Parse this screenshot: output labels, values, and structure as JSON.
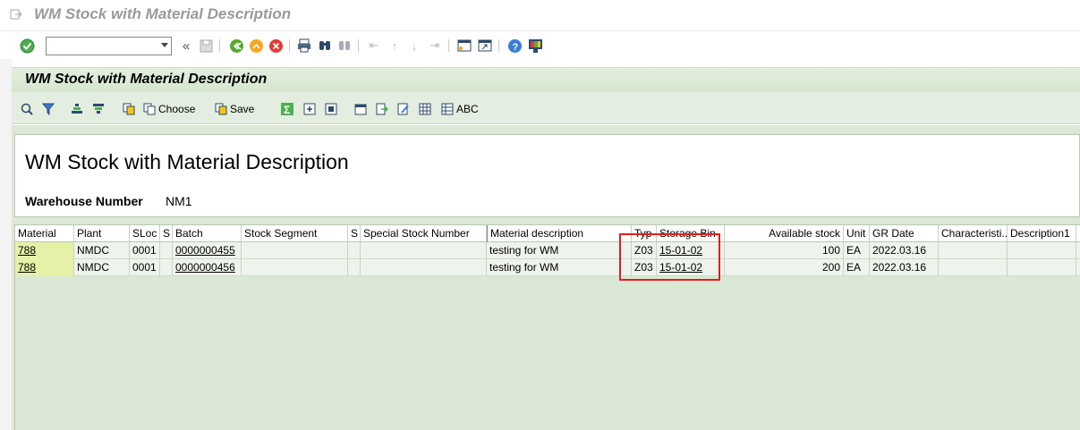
{
  "window": {
    "title": "WM Stock with Material Description"
  },
  "system_toolbar": {
    "command_field_value": ""
  },
  "app": {
    "title": "WM Stock with Material Description",
    "toolbar": {
      "choose_label": "Choose",
      "save_label": "Save",
      "abc_label": "ABC"
    }
  },
  "report": {
    "heading": "WM Stock with Material Description",
    "warehouse_label": "Warehouse Number",
    "warehouse_value": "NM1"
  },
  "table": {
    "columns": [
      "Material",
      "Plant",
      "SLoc",
      "S",
      "Batch",
      "Stock Segment",
      "S",
      "Special Stock Number",
      "Material description",
      "Typ",
      "Storage Bin",
      "Available stock",
      "Unit",
      "GR Date",
      "Characteristi...",
      "Description1"
    ],
    "rows": [
      [
        "788",
        "NMDC",
        "0001",
        "",
        "0000000455",
        "",
        "",
        "",
        "testing for WM",
        "Z03",
        "15-01-02",
        "100",
        "EA",
        "2022.03.16",
        "",
        ""
      ],
      [
        "788",
        "NMDC",
        "0001",
        "",
        "0000000456",
        "",
        "",
        "",
        "testing for WM",
        "Z03",
        "15-01-02",
        "200",
        "EA",
        "2022.03.16",
        "",
        ""
      ]
    ]
  },
  "colors": {
    "accent_green": "#dbe8d6",
    "highlight_red": "#e01f1f",
    "material_cell": "#e6f0a6"
  }
}
